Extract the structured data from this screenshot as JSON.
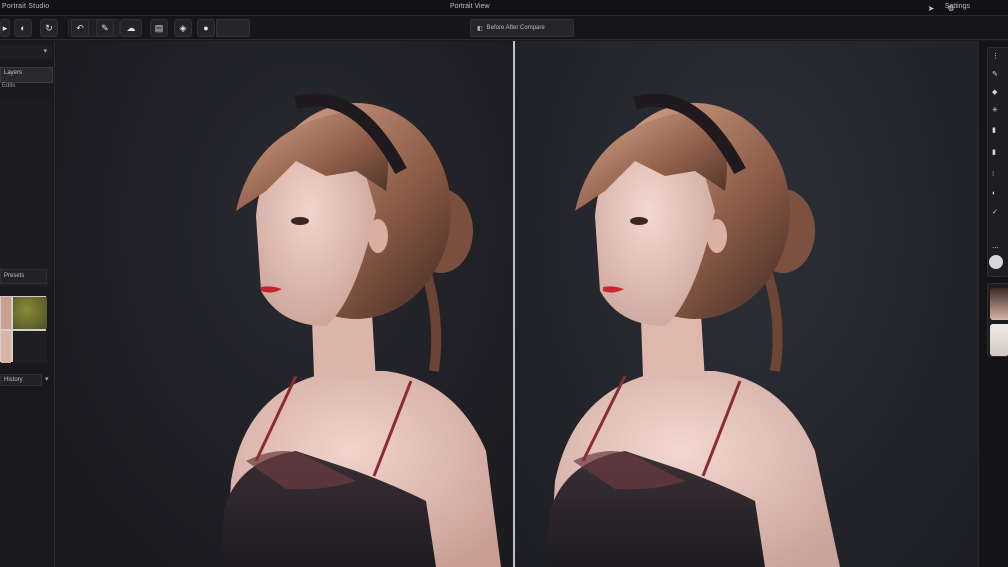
{
  "titlebar": {
    "app_title": "Portrait Studio",
    "document_title": "Portrait View",
    "right_label": "Settings"
  },
  "toolbar": {
    "compare_label": "Before After Compare"
  },
  "left_panel": {
    "item_label": "Layers",
    "item_sub": "Edits",
    "section_label": "Presets",
    "footer_label": "History"
  },
  "icons": [
    "brush-icon",
    "mask-icon",
    "refresh-icon",
    "undo-icon",
    "pen-icon",
    "cloud-icon",
    "document-icon",
    "shield-icon",
    "dot-icon",
    "gear-icon",
    "export-icon"
  ]
}
